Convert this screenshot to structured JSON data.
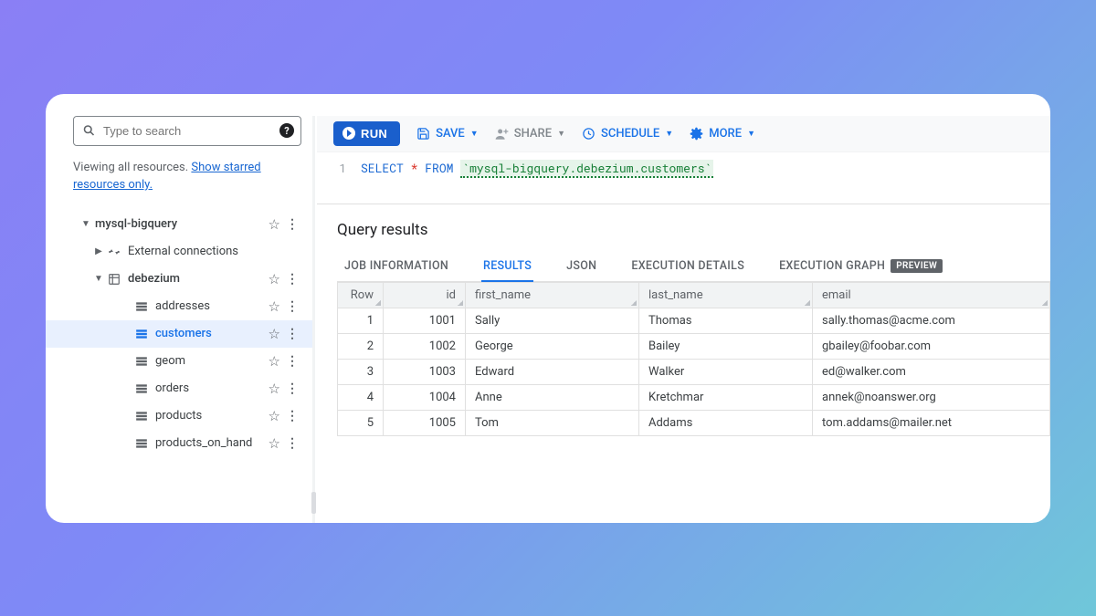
{
  "sidebar": {
    "search_placeholder": "Type to search",
    "viewing_prefix": "Viewing all resources. ",
    "viewing_link": "Show starred resources only.",
    "project": "mysql-bigquery",
    "external": "External connections",
    "dataset": "debezium",
    "tables": [
      "addresses",
      "customers",
      "geom",
      "orders",
      "products",
      "products_on_hand"
    ],
    "active_table_index": 1
  },
  "toolbar": {
    "run": "RUN",
    "save": "SAVE",
    "share": "SHARE",
    "schedule": "SCHEDULE",
    "more": "MORE"
  },
  "editor": {
    "line_no": "1",
    "kw_select": "SELECT",
    "sym_star": "*",
    "kw_from": "FROM",
    "table_ref": "`mysql-bigquery.debezium.customers`"
  },
  "results": {
    "title": "Query results",
    "tabs": {
      "job": "JOB INFORMATION",
      "results": "RESULTS",
      "json": "JSON",
      "exec": "EXECUTION DETAILS",
      "graph": "EXECUTION GRAPH",
      "preview_badge": "PREVIEW"
    },
    "columns": {
      "row": "Row",
      "id": "id",
      "first_name": "first_name",
      "last_name": "last_name",
      "email": "email"
    },
    "rows": [
      {
        "n": "1",
        "id": "1001",
        "first": "Sally",
        "last": "Thomas",
        "email": "sally.thomas@acme.com"
      },
      {
        "n": "2",
        "id": "1002",
        "first": "George",
        "last": "Bailey",
        "email": "gbailey@foobar.com"
      },
      {
        "n": "3",
        "id": "1003",
        "first": "Edward",
        "last": "Walker",
        "email": "ed@walker.com"
      },
      {
        "n": "4",
        "id": "1004",
        "first": "Anne",
        "last": "Kretchmar",
        "email": "annek@noanswer.org"
      },
      {
        "n": "5",
        "id": "1005",
        "first": "Tom",
        "last": "Addams",
        "email": "tom.addams@mailer.net"
      }
    ]
  }
}
